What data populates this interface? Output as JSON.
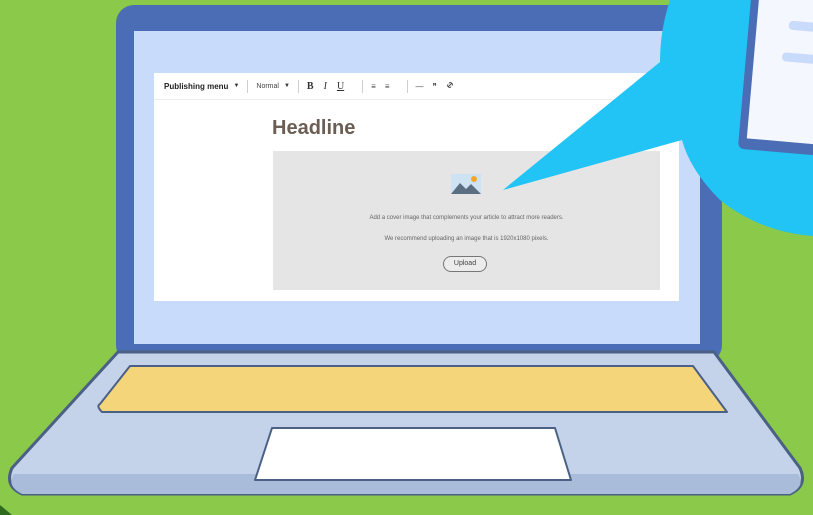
{
  "toolbar": {
    "publishing_menu": "Publishing menu",
    "style_select": "Normal",
    "bold": "B",
    "italic": "I",
    "underline": "U",
    "bullet_list": "≡",
    "numbered_list": "≡",
    "divider": "—",
    "quote": "❞",
    "link": "🔗"
  },
  "editor": {
    "headline": "Headline",
    "cover_text_1": "Add a cover image that complements your article to attract more readers.",
    "cover_text_2": "We recommend uploading an image that is 1920x1080 pixels.",
    "upload_label": "Upload"
  },
  "colors": {
    "background": "#8bc94a",
    "laptop_frame": "#4a6db5",
    "screen_bg": "#c9dbfa",
    "keyboard": "#f5d57a",
    "bubble": "#22c3f5"
  }
}
